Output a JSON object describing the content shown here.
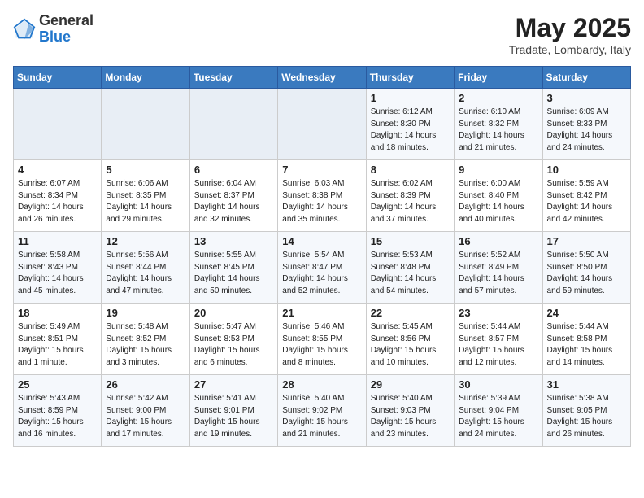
{
  "header": {
    "logo_general": "General",
    "logo_blue": "Blue",
    "month_year": "May 2025",
    "location": "Tradate, Lombardy, Italy"
  },
  "days_of_week": [
    "Sunday",
    "Monday",
    "Tuesday",
    "Wednesday",
    "Thursday",
    "Friday",
    "Saturday"
  ],
  "weeks": [
    [
      {
        "day": "",
        "detail": ""
      },
      {
        "day": "",
        "detail": ""
      },
      {
        "day": "",
        "detail": ""
      },
      {
        "day": "",
        "detail": ""
      },
      {
        "day": "1",
        "detail": "Sunrise: 6:12 AM\nSunset: 8:30 PM\nDaylight: 14 hours\nand 18 minutes."
      },
      {
        "day": "2",
        "detail": "Sunrise: 6:10 AM\nSunset: 8:32 PM\nDaylight: 14 hours\nand 21 minutes."
      },
      {
        "day": "3",
        "detail": "Sunrise: 6:09 AM\nSunset: 8:33 PM\nDaylight: 14 hours\nand 24 minutes."
      }
    ],
    [
      {
        "day": "4",
        "detail": "Sunrise: 6:07 AM\nSunset: 8:34 PM\nDaylight: 14 hours\nand 26 minutes."
      },
      {
        "day": "5",
        "detail": "Sunrise: 6:06 AM\nSunset: 8:35 PM\nDaylight: 14 hours\nand 29 minutes."
      },
      {
        "day": "6",
        "detail": "Sunrise: 6:04 AM\nSunset: 8:37 PM\nDaylight: 14 hours\nand 32 minutes."
      },
      {
        "day": "7",
        "detail": "Sunrise: 6:03 AM\nSunset: 8:38 PM\nDaylight: 14 hours\nand 35 minutes."
      },
      {
        "day": "8",
        "detail": "Sunrise: 6:02 AM\nSunset: 8:39 PM\nDaylight: 14 hours\nand 37 minutes."
      },
      {
        "day": "9",
        "detail": "Sunrise: 6:00 AM\nSunset: 8:40 PM\nDaylight: 14 hours\nand 40 minutes."
      },
      {
        "day": "10",
        "detail": "Sunrise: 5:59 AM\nSunset: 8:42 PM\nDaylight: 14 hours\nand 42 minutes."
      }
    ],
    [
      {
        "day": "11",
        "detail": "Sunrise: 5:58 AM\nSunset: 8:43 PM\nDaylight: 14 hours\nand 45 minutes."
      },
      {
        "day": "12",
        "detail": "Sunrise: 5:56 AM\nSunset: 8:44 PM\nDaylight: 14 hours\nand 47 minutes."
      },
      {
        "day": "13",
        "detail": "Sunrise: 5:55 AM\nSunset: 8:45 PM\nDaylight: 14 hours\nand 50 minutes."
      },
      {
        "day": "14",
        "detail": "Sunrise: 5:54 AM\nSunset: 8:47 PM\nDaylight: 14 hours\nand 52 minutes."
      },
      {
        "day": "15",
        "detail": "Sunrise: 5:53 AM\nSunset: 8:48 PM\nDaylight: 14 hours\nand 54 minutes."
      },
      {
        "day": "16",
        "detail": "Sunrise: 5:52 AM\nSunset: 8:49 PM\nDaylight: 14 hours\nand 57 minutes."
      },
      {
        "day": "17",
        "detail": "Sunrise: 5:50 AM\nSunset: 8:50 PM\nDaylight: 14 hours\nand 59 minutes."
      }
    ],
    [
      {
        "day": "18",
        "detail": "Sunrise: 5:49 AM\nSunset: 8:51 PM\nDaylight: 15 hours\nand 1 minute."
      },
      {
        "day": "19",
        "detail": "Sunrise: 5:48 AM\nSunset: 8:52 PM\nDaylight: 15 hours\nand 3 minutes."
      },
      {
        "day": "20",
        "detail": "Sunrise: 5:47 AM\nSunset: 8:53 PM\nDaylight: 15 hours\nand 6 minutes."
      },
      {
        "day": "21",
        "detail": "Sunrise: 5:46 AM\nSunset: 8:55 PM\nDaylight: 15 hours\nand 8 minutes."
      },
      {
        "day": "22",
        "detail": "Sunrise: 5:45 AM\nSunset: 8:56 PM\nDaylight: 15 hours\nand 10 minutes."
      },
      {
        "day": "23",
        "detail": "Sunrise: 5:44 AM\nSunset: 8:57 PM\nDaylight: 15 hours\nand 12 minutes."
      },
      {
        "day": "24",
        "detail": "Sunrise: 5:44 AM\nSunset: 8:58 PM\nDaylight: 15 hours\nand 14 minutes."
      }
    ],
    [
      {
        "day": "25",
        "detail": "Sunrise: 5:43 AM\nSunset: 8:59 PM\nDaylight: 15 hours\nand 16 minutes."
      },
      {
        "day": "26",
        "detail": "Sunrise: 5:42 AM\nSunset: 9:00 PM\nDaylight: 15 hours\nand 17 minutes."
      },
      {
        "day": "27",
        "detail": "Sunrise: 5:41 AM\nSunset: 9:01 PM\nDaylight: 15 hours\nand 19 minutes."
      },
      {
        "day": "28",
        "detail": "Sunrise: 5:40 AM\nSunset: 9:02 PM\nDaylight: 15 hours\nand 21 minutes."
      },
      {
        "day": "29",
        "detail": "Sunrise: 5:40 AM\nSunset: 9:03 PM\nDaylight: 15 hours\nand 23 minutes."
      },
      {
        "day": "30",
        "detail": "Sunrise: 5:39 AM\nSunset: 9:04 PM\nDaylight: 15 hours\nand 24 minutes."
      },
      {
        "day": "31",
        "detail": "Sunrise: 5:38 AM\nSunset: 9:05 PM\nDaylight: 15 hours\nand 26 minutes."
      }
    ]
  ]
}
